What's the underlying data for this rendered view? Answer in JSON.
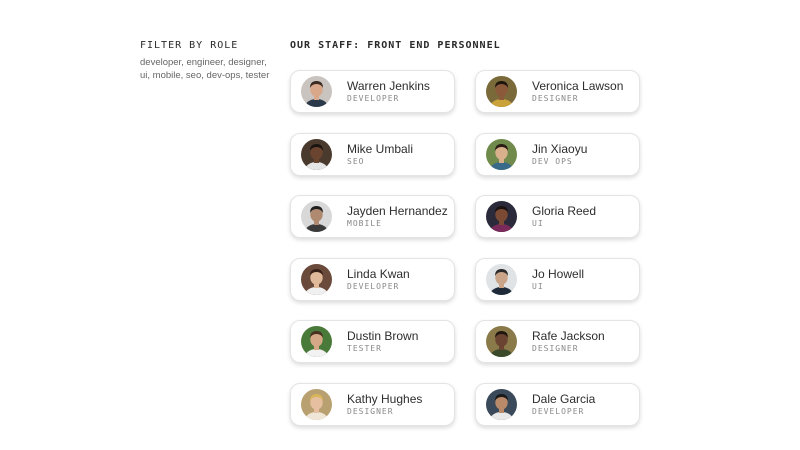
{
  "sidebar": {
    "title": "FILTER BY ROLE",
    "roles": "developer, engineer, designer, ui, mobile, seo, dev-ops, tester"
  },
  "main": {
    "title": "OUR STAFF: FRONT END PERSONNEL"
  },
  "staff": [
    {
      "name": "Warren Jenkins",
      "role": "DEVELOPER",
      "bg": "#c9c4bf",
      "skin": "#d9a78a",
      "hair": "#3a2a20",
      "shirt": "#2b3a4a"
    },
    {
      "name": "Veronica Lawson",
      "role": "DESIGNER",
      "bg": "#7a6a3a",
      "skin": "#8a5a3a",
      "hair": "#1e140e",
      "shirt": "#c9a23a"
    },
    {
      "name": "Mike Umbali",
      "role": "SEO",
      "bg": "#4a3a2e",
      "skin": "#6b4430",
      "hair": "#1a1410",
      "shirt": "#e6e6e6"
    },
    {
      "name": "Jin Xiaoyu",
      "role": "DEV OPS",
      "bg": "#6f8a4a",
      "skin": "#d9b08c",
      "hair": "#2a1e16",
      "shirt": "#3a6a8a"
    },
    {
      "name": "Jayden Hernandez",
      "role": "MOBILE",
      "bg": "#d8d8d8",
      "skin": "#b08a70",
      "hair": "#202020",
      "shirt": "#3a3a3a"
    },
    {
      "name": "Gloria Reed",
      "role": "UI",
      "bg": "#2a2a3a",
      "skin": "#7a4a34",
      "hair": "#1a1212",
      "shirt": "#7a2a5a"
    },
    {
      "name": "Linda Kwan",
      "role": "DEVELOPER",
      "bg": "#6a4a3a",
      "skin": "#e0b89a",
      "hair": "#3a2218",
      "shirt": "#f0f0f0"
    },
    {
      "name": "Jo Howell",
      "role": "UI",
      "bg": "#dfe3e6",
      "skin": "#c9a488",
      "hair": "#2a2a2a",
      "shirt": "#1e2a3a"
    },
    {
      "name": "Dustin Brown",
      "role": "TESTER",
      "bg": "#4a7a3a",
      "skin": "#d6a888",
      "hair": "#4a3222",
      "shirt": "#f2f2f2"
    },
    {
      "name": "Rafe Jackson",
      "role": "DESIGNER",
      "bg": "#8a7a4a",
      "skin": "#6a4430",
      "hair": "#201610",
      "shirt": "#3a4a2a"
    },
    {
      "name": "Kathy Hughes",
      "role": "DESIGNER",
      "bg": "#b8a070",
      "skin": "#e6bfa0",
      "hair": "#d8b45a",
      "shirt": "#f0e6d8"
    },
    {
      "name": "Dale Garcia",
      "role": "DEVELOPER",
      "bg": "#3a4a5a",
      "skin": "#b88a6a",
      "hair": "#1a1a1a",
      "shirt": "#e8e8e8"
    }
  ]
}
